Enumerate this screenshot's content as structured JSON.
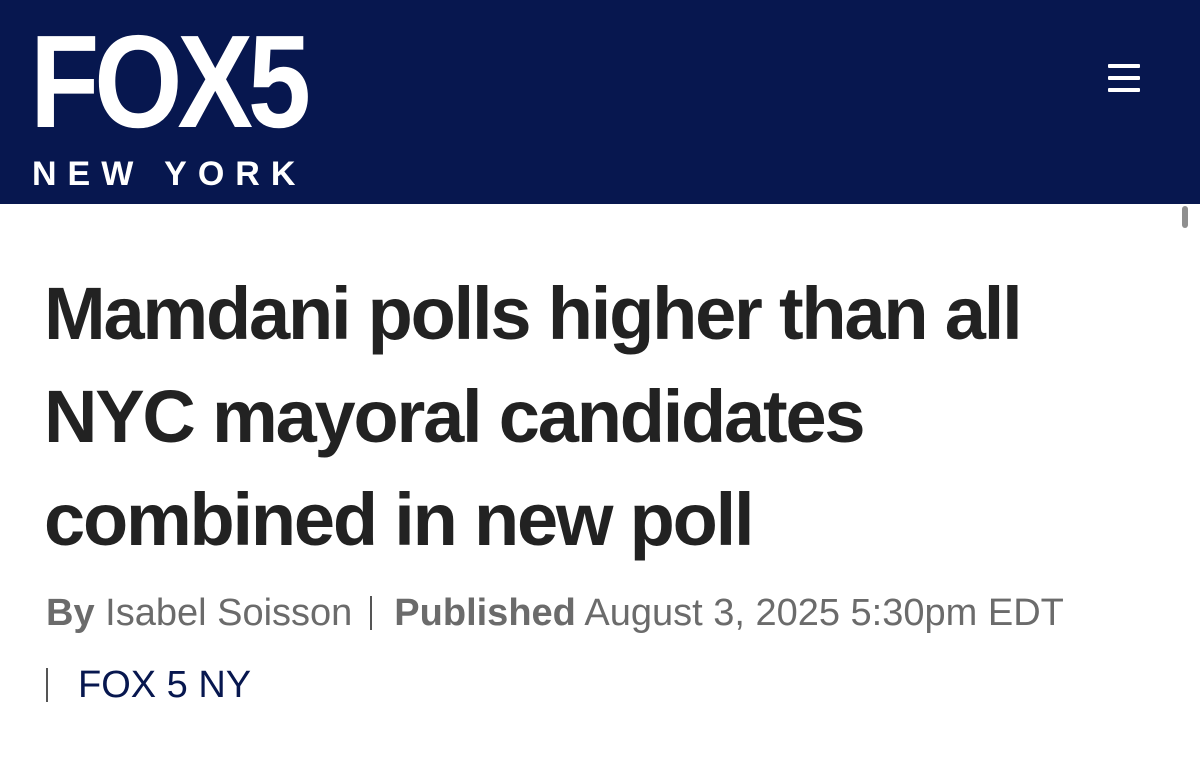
{
  "header": {
    "logo_main": "FOX5",
    "logo_sub": "NEW YORK",
    "bg_color": "#07174f",
    "menu_icon": "hamburger-menu-icon"
  },
  "article": {
    "headline": "Mamdani polls higher than all NYC mayoral candidates combined in new poll",
    "byline": {
      "by_label": "By",
      "author": "Isabel Soisson",
      "published_label": "Published",
      "published_date": "August 3, 2025 5:30pm EDT",
      "source": "FOX 5 NY"
    }
  }
}
